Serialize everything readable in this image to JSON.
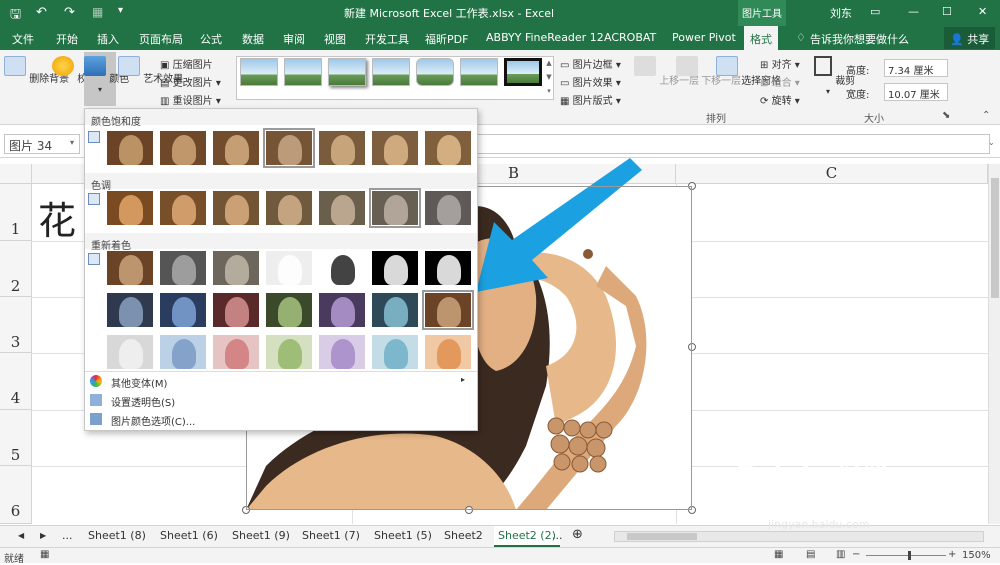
{
  "title_bar": {
    "doc_title": "新建 Microsoft Excel 工作表.xlsx  -  Excel",
    "context_tool": "图片工具",
    "user": "刘东"
  },
  "tabs": [
    "文件",
    "开始",
    "插入",
    "页面布局",
    "公式",
    "数据",
    "审阅",
    "视图",
    "开发工具",
    "福昕PDF",
    "ABBYY FineReader 12",
    "ACROBAT",
    "Power Pivot",
    "格式"
  ],
  "active_tab": "格式",
  "tell_me": "告诉我你想要做什么",
  "share": "共享",
  "ribbon": {
    "remove_bg": "删除背景",
    "corrections": "校正",
    "color": "颜色",
    "artistic": "艺术效果",
    "compress": "压缩图片",
    "change": "更改图片",
    "reset": "重设图片",
    "pic_border": "图片边框",
    "pic_effects": "图片效果",
    "pic_layout": "图片版式",
    "bring_forward": "上移一层",
    "send_backward": "下移一层",
    "selection_pane": "选择窗格",
    "align": "对齐",
    "group": "组合",
    "rotate": "旋转",
    "crop": "裁剪",
    "height_label": "高度:",
    "height_value": "7.34 厘米",
    "width_label": "宽度:",
    "width_value": "10.07 厘米",
    "arrange_label": "排列",
    "size_label": "大小"
  },
  "namebox": "图片 34",
  "columns": [
    "B",
    "C"
  ],
  "rows": [
    "1",
    "2",
    "3",
    "4",
    "5",
    "6"
  ],
  "cell_a1": "花",
  "dropdown": {
    "saturation": "颜色饱和度",
    "tone": "色调",
    "recolor": "重新着色",
    "more_variations": "其他变体(M)",
    "set_transparent": "设置透明色(S)",
    "color_options": "图片颜色选项(C)..."
  },
  "sheets": [
    "...",
    "Sheet1 (8)",
    "Sheet1 (6)",
    "Sheet1 (9)",
    "Sheet1 (7)",
    "Sheet1 (5)",
    "Sheet2",
    "Sheet2 (2)",
    "..."
  ],
  "active_sheet": "Sheet2 (2)",
  "status": {
    "ready": "就绪",
    "zoom": "150%"
  },
  "watermark": {
    "main": "Bai  du 经验",
    "sub": "jingyan.baidu.com"
  },
  "colors": {
    "accent": "#217346",
    "arrow": "#1ba1e2",
    "skin": "#e7b889"
  }
}
